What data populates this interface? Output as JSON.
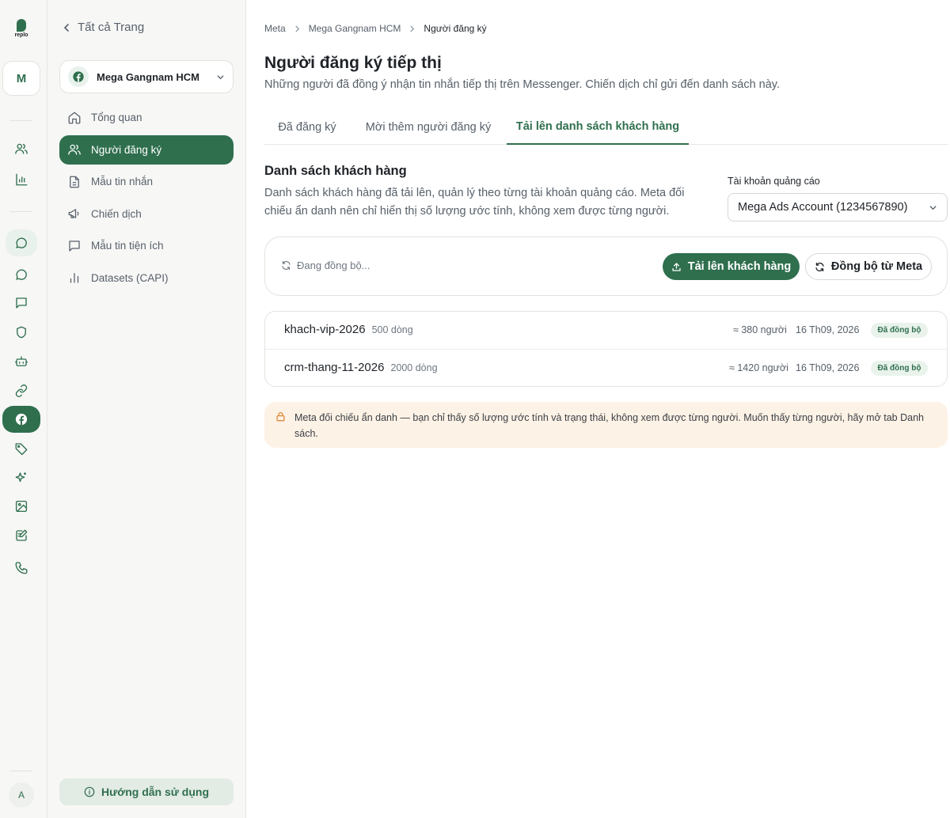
{
  "rail": {
    "logo_text": "replo",
    "workspace_initial": "M",
    "avatar_initial": "A",
    "icons": [
      "users-icon",
      "bar-chart-icon",
      "message-circle-icon",
      "chat-bubble-icon",
      "message-square-icon",
      "shield-icon",
      "bot-icon",
      "link-icon",
      "facebook-icon",
      "tag-icon",
      "sparkles-icon",
      "image-icon",
      "edit-note-icon",
      "phone-icon"
    ]
  },
  "sidebar": {
    "back_label": "Tất cả Trang",
    "page_name": "Mega Gangnam HCM",
    "items": [
      {
        "label": "Tổng quan",
        "icon": "home-icon"
      },
      {
        "label": "Người đăng ký",
        "icon": "users-icon"
      },
      {
        "label": "Mẫu tin nhắn",
        "icon": "file-text-icon"
      },
      {
        "label": "Chiến dịch",
        "icon": "megaphone-icon"
      },
      {
        "label": "Mẫu tin tiện ích",
        "icon": "message-square-icon"
      },
      {
        "label": "Datasets (CAPI)",
        "icon": "bar-chart-icon"
      }
    ],
    "help_label": "Hướng dẫn sử dụng"
  },
  "breadcrumb": {
    "items": [
      "Meta",
      "Mega Gangnam HCM",
      "Người đăng ký"
    ]
  },
  "page": {
    "title": "Người đăng ký tiếp thị",
    "subtitle": "Những người đã đồng ý nhận tin nhắn tiếp thị trên Messenger. Chiến dịch chỉ gửi đến danh sách này."
  },
  "tabs": [
    {
      "label": "Đã đăng ký"
    },
    {
      "label": "Mời thêm người đăng ký"
    },
    {
      "label": "Tải lên danh sách khách hàng"
    }
  ],
  "section": {
    "title": "Danh sách khách hàng",
    "description": "Danh sách khách hàng đã tải lên, quản lý theo từng tài khoản quảng cáo. Meta đối chiếu ẩn danh nên chỉ hiển thị số lượng ước tính, không xem được từng người.",
    "account_label": "Tài khoản quảng cáo",
    "account_value": "Mega Ads Account (1234567890)"
  },
  "toolbar": {
    "sync_status": "Đang đồng bộ...",
    "upload_label": "Tải lên khách hàng",
    "sync_label": "Đồng bộ từ Meta"
  },
  "lists": [
    {
      "name": "khach-vip-2026",
      "rows": "500 dòng",
      "people": "≈ 380 người",
      "date": "16 Th09, 2026",
      "status": "Đã đồng bộ"
    },
    {
      "name": "crm-thang-11-2026",
      "rows": "2000 dòng",
      "people": "≈ 1420 người",
      "date": "16 Th09, 2026",
      "status": "Đã đồng bộ"
    }
  ],
  "notice": {
    "text": "Meta đối chiếu ẩn danh — bạn chỉ thấy số lượng ước tính và trạng thái, không xem được từng người. Muốn thấy từng người, hãy mở tab Danh sách."
  },
  "colors": {
    "accent": "#2f6f4e",
    "accent_soft": "#e9f1ec",
    "notice_bg": "#fdf2e6",
    "notice_icon": "#d9822b"
  }
}
